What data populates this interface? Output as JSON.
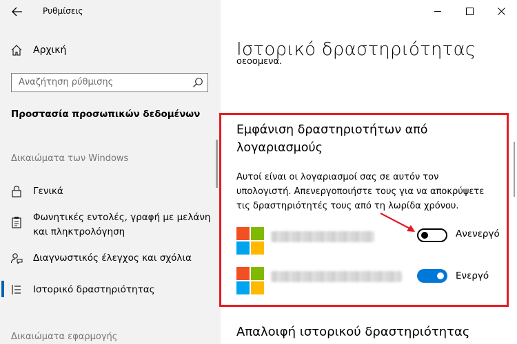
{
  "window": {
    "title": "Ρυθμίσεις",
    "controls": {
      "minimize": "—",
      "maximize": "☐",
      "close": "✕"
    }
  },
  "sidebar": {
    "home_label": "Αρχική",
    "search_placeholder": "Αναζήτηση ρύθμισης",
    "section_title": "Προστασία προσωπικών δεδομένων",
    "group_windows": "Δικαιώματα των Windows",
    "items": [
      {
        "label": "Γενικά",
        "icon": "lock-icon"
      },
      {
        "label": "Φωνητικές εντολές, γραφή με μελάνη και πληκτρολόγηση",
        "icon": "clipboard-icon"
      },
      {
        "label": "Διαγνωστικός έλεγχος και σχόλια",
        "icon": "feedback-person-icon"
      },
      {
        "label": "Ιστορικό δραστηριότητας",
        "icon": "timeline-icon",
        "selected": true
      }
    ],
    "group_apps": "Δικαιώματα εφαρμογής"
  },
  "main": {
    "page_title": "Ιστορικό δραστηριότητας",
    "clipped_text": "δεδομένα.",
    "card": {
      "title": "Εμφάνιση δραστηριοτήτων από λογαριασμούς",
      "description": "Αυτοί είναι οι λογαριασμοί σας σε αυτόν τον υπολογιστή. Απενεργοποιήστε τους για να αποκρύψετε τις δραστηριότητές τους από τη λωρίδα χρόνου.",
      "accounts": [
        {
          "state_label": "Ανενεργό",
          "on": false
        },
        {
          "state_label": "Ενεργό",
          "on": true
        }
      ]
    },
    "bottom_heading": "Απαλοιφή ιστορικού δραστηριότητας"
  },
  "colors": {
    "accent": "#0078d7",
    "highlight": "#e51a22",
    "ms_red": "#f25022",
    "ms_green": "#7fba00",
    "ms_blue": "#00a4ef",
    "ms_yellow": "#ffb900"
  }
}
